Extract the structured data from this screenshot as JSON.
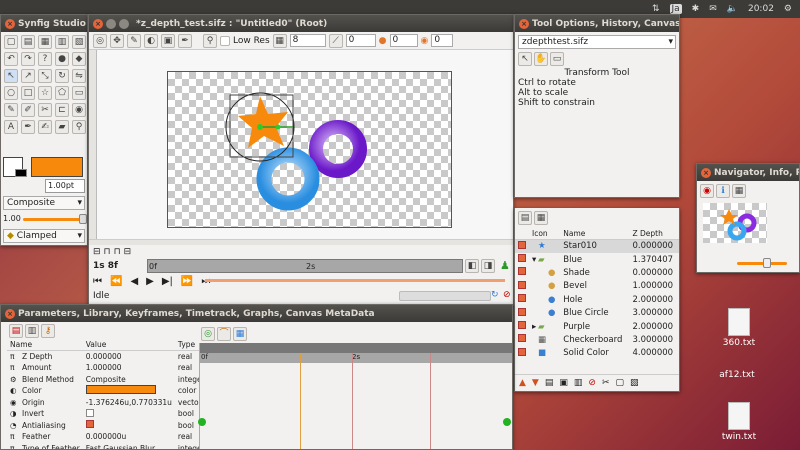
{
  "top_panel": {
    "lang": "Ja",
    "time": "20:02"
  },
  "toolbox": {
    "title": "Synfig Studio",
    "width_value": "1.00pt",
    "blend": "Composite",
    "amount": "1.00",
    "interp": "Clamped"
  },
  "canvas": {
    "title": "*z_depth_test.sifz : \"Untitled0\" (Root)",
    "low_res": "Low Res",
    "thumb_value": "8",
    "angle1": "0",
    "angle2": "0",
    "angle3": "0",
    "time": "1s 8f",
    "tick_start": "0f",
    "tick_2s": "2s",
    "status": "Idle"
  },
  "tool_options": {
    "title": "Tool Options, History, Canvas Bro",
    "file": "zdepthtest.sifz",
    "heading": "Transform Tool",
    "hints": [
      "Ctrl to rotate",
      "Alt to scale",
      "Shift to constrain"
    ]
  },
  "layers": {
    "headers": [
      "Icon",
      "Name",
      "Z Depth"
    ],
    "rows": [
      {
        "name": "Star010",
        "z": "0.000000",
        "icon": "star-icon",
        "indent": 0,
        "selected": true
      },
      {
        "name": "Blue",
        "z": "1.370407",
        "icon": "folder-icon",
        "indent": 0,
        "expanded": true
      },
      {
        "name": "Shade",
        "z": "0.000000",
        "icon": "shade-icon",
        "indent": 1
      },
      {
        "name": "Bevel",
        "z": "1.000000",
        "icon": "bevel-icon",
        "indent": 1
      },
      {
        "name": "Hole",
        "z": "2.000000",
        "icon": "circle-icon",
        "indent": 1
      },
      {
        "name": "Blue Circle",
        "z": "3.000000",
        "icon": "circle-icon",
        "indent": 1
      },
      {
        "name": "Purple",
        "z": "2.000000",
        "icon": "folder-icon",
        "indent": 0,
        "collapsed": true
      },
      {
        "name": "Checkerboard",
        "z": "3.000000",
        "icon": "checkerboard-icon",
        "indent": 0
      },
      {
        "name": "Solid Color",
        "z": "4.000000",
        "icon": "solid-color-icon",
        "indent": 0
      }
    ]
  },
  "navigator": {
    "title": "Navigator, Info, Pa"
  },
  "params": {
    "title": "Parameters, Library, Keyframes, Timetrack, Graphs, Canvas MetaData",
    "headers": [
      "Name",
      "Value",
      "Type"
    ],
    "rows": [
      {
        "name": "Z Depth",
        "value": "0.000000",
        "type": "real",
        "icon": "pi-icon"
      },
      {
        "name": "Amount",
        "value": "1.000000",
        "type": "real",
        "icon": "pi-icon"
      },
      {
        "name": "Blend Method",
        "value": "Composite",
        "type": "integer",
        "icon": "blend-icon"
      },
      {
        "name": "Color",
        "value": "",
        "type": "color",
        "icon": "color-icon"
      },
      {
        "name": "Origin",
        "value": "-1.376246u,0.770331u",
        "type": "vector (A",
        "icon": "origin-icon"
      },
      {
        "name": "Invert",
        "value": "",
        "type": "bool",
        "icon": "invert-icon"
      },
      {
        "name": "Antialiasing",
        "value": "",
        "type": "bool",
        "icon": "antialias-icon"
      },
      {
        "name": "Feather",
        "value": "0.000000u",
        "type": "real",
        "icon": "pi-icon"
      },
      {
        "name": "Type of Feather",
        "value": "Fast Gaussian Blur",
        "type": "integer",
        "icon": "pi-icon"
      }
    ],
    "tick_start": "0f",
    "tick_2s": "2s"
  },
  "desktop": {
    "files": [
      "360.txt",
      "af12.txt",
      "twin.txt"
    ]
  },
  "colors": {
    "orange": "#f7890c",
    "blue": "#3aa6ef",
    "purple": "#8a2be2",
    "title_bar": "#3b3a37",
    "ubuntu_orange": "#e5653b"
  }
}
